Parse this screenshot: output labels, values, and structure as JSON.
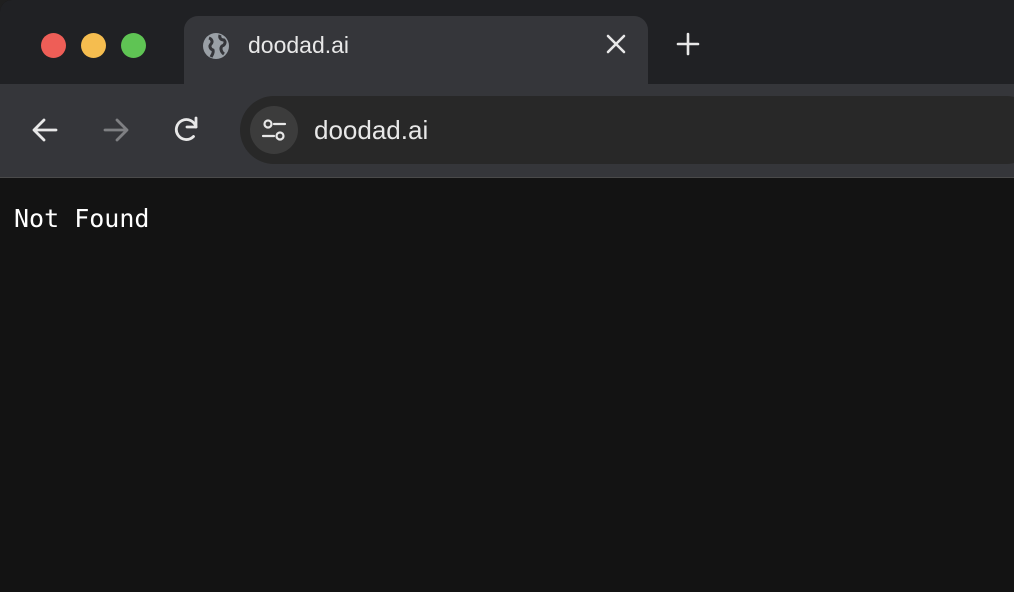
{
  "window": {
    "controls": [
      "close",
      "minimize",
      "zoom"
    ],
    "colors": {
      "close": "#ee5e57",
      "minimize": "#f5bd4f",
      "zoom": "#5fc454"
    }
  },
  "tab": {
    "title": "doodad.ai",
    "icon": "globe-icon",
    "close_icon": "close-icon"
  },
  "toolbar": {
    "back_icon": "back-arrow-icon",
    "forward_icon": "forward-arrow-icon",
    "reload_icon": "reload-icon",
    "site_info_icon": "tune-icon",
    "url": "doodad.ai"
  },
  "new_tab_icon": "plus-icon",
  "page": {
    "body_text": "Not Found"
  }
}
